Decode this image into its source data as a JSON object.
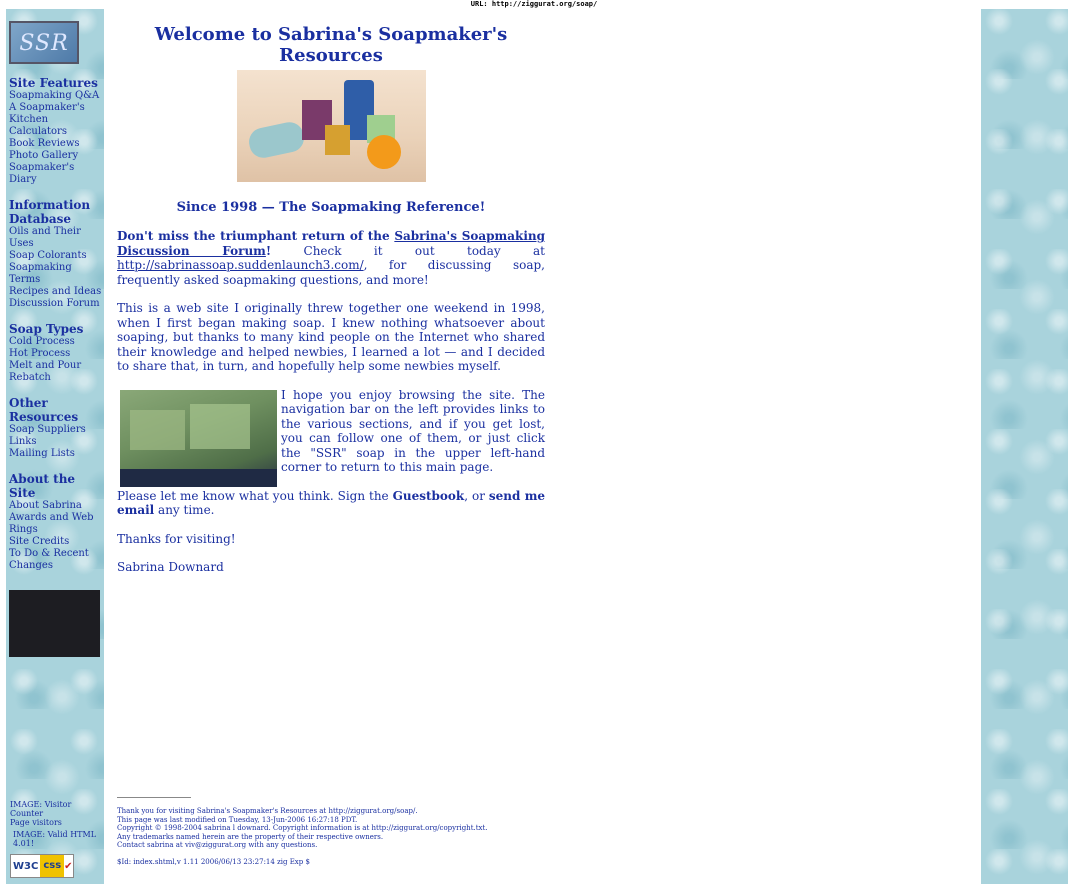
{
  "url_bar": "URL: http://ziggurat.org/soap/",
  "logo_text": "SSR",
  "sidebar": {
    "sections": [
      {
        "heading": "Site Features",
        "links": [
          "Soapmaking Q&A",
          "A Soapmaker's Kitchen",
          "Calculators",
          "Book Reviews",
          "Photo Gallery",
          "Soapmaker's Diary"
        ]
      },
      {
        "heading": "Information Database",
        "links": [
          "Oils and Their Uses",
          "Soap Colorants",
          "Soapmaking Terms",
          "Recipes and Ideas",
          "Discussion Forum"
        ]
      },
      {
        "heading": "Soap Types",
        "links": [
          "Cold Process",
          "Hot Process",
          "Melt and Pour",
          "Rebatch"
        ]
      },
      {
        "heading": "Other Resources",
        "links": [
          "Soap Suppliers",
          "Links",
          "Mailing Lists"
        ]
      },
      {
        "heading": "About the Site",
        "links": [
          "About Sabrina",
          "Awards and Web Rings",
          "Site Credits",
          "To Do & Recent Changes"
        ]
      }
    ],
    "bottom": {
      "counter_image": "IMAGE: Visitor Counter",
      "page_visitors": "Page visitors",
      "valid_html": "IMAGE: Valid HTML 4.01!",
      "w3c_badge": {
        "w3c": "W3C",
        "css": "css"
      }
    }
  },
  "main": {
    "title": "Welcome to Sabrina's Soapmaker's Resources",
    "tagline": "Since 1998 — The Soapmaking Reference!",
    "p1": {
      "lead": "Don't miss the triumphant return of the ",
      "forum_link": "Sabrina's Soapmaking Discussion Forum",
      "excl": "!",
      "mid": " Check it out today at ",
      "url_link": "http://sabrinassoap.suddenlaunch3.com/",
      "tail": ", for discussing soap, frequently asked soapmaking questions, and more!"
    },
    "p2": "This is a web site I originally threw together one weekend in 1998, when I first began making soap. I knew nothing whatsoever about soaping, but thanks to many kind people on the Internet who shared their knowledge and helped newbies, I learned a lot — and I decided to share that, in turn, and hopefully help some newbies myself.",
    "p3": "I hope you enjoy browsing the site. The navigation bar on the left provides links to the various sections, and if you get lost, you can follow one of them, or just click the \"SSR\" soap in the upper left-hand corner to return to this main page.",
    "p4": {
      "lead": "Please let me know what you think. Sign the ",
      "guestbook": "Guestbook",
      "mid": ", or ",
      "email": "send me email",
      "tail": " any time."
    },
    "thanks": "Thanks for visiting!",
    "signature": "Sabrina Downard"
  },
  "footer": {
    "lines": [
      "Thank you for visiting Sabrina's Soapmaker's Resources at http://ziggurat.org/soap/.",
      "This page was last modified on Tuesday, 13-Jun-2006 16:27:18 PDT.",
      "Copyright © 1998-2004 sabrina l downard. Copyright information is at http://ziggurat.org/copyright.txt.",
      "Any trademarks named herein are the property of their respective owners.",
      "Contact sabrina at viv@ziggurat.org with any questions."
    ],
    "id_line": "$Id: index.shtml,v 1.11 2006/06/13 23:27:14 zig Exp $"
  }
}
